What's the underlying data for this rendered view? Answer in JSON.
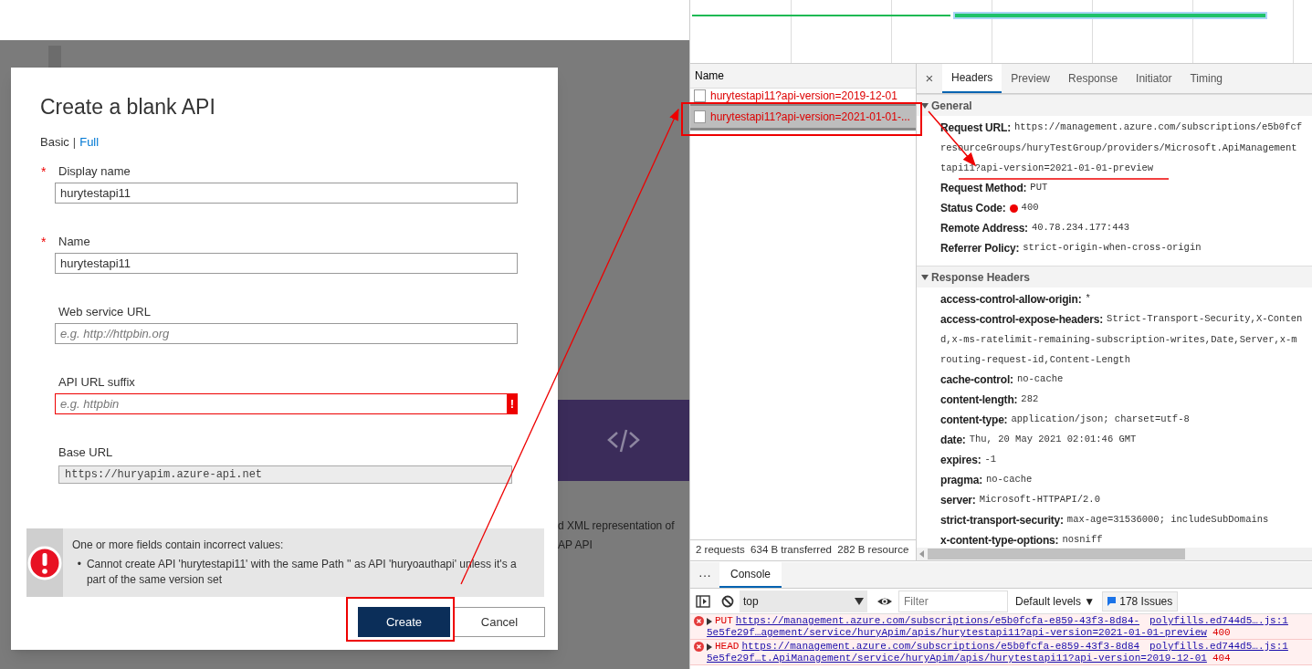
{
  "portal": {
    "dialog": {
      "title": "Create a blank API",
      "modes": [
        {
          "label": "Basic",
          "selected": true
        },
        {
          "label": "Full",
          "selected": false
        }
      ],
      "separator": "|",
      "fields": [
        {
          "kind": "text",
          "label": "Display name",
          "required": true,
          "value": "hurytestapi11"
        },
        {
          "kind": "text",
          "label": "Name",
          "required": true,
          "value": "hurytestapi11"
        },
        {
          "kind": "text",
          "label": "Web service URL",
          "placeholder": "e.g. http://httpbin.org"
        },
        {
          "kind": "text",
          "label": "API URL suffix",
          "placeholder": "e.g. httpbin",
          "error": true,
          "error_mark": "!"
        },
        {
          "kind": "readonly",
          "label": "Base URL",
          "value": "https://huryapim.azure-api.net"
        }
      ],
      "required_mark": "*",
      "error_banner": {
        "title": "One or more fields contain incorrect values:",
        "bullet": "•",
        "items": [
          "Cannot create API 'hurytestapi11' with the same Path '' as API 'huryoauthapi' unless it's a part of the same version set"
        ]
      },
      "buttons": [
        {
          "label": "Create",
          "primary": true
        },
        {
          "label": "Cancel",
          "primary": false
        }
      ]
    },
    "background_card": {
      "lines": [
        "d XML representation of",
        "AP API"
      ]
    }
  },
  "devtools": {
    "name_column": "Name",
    "requests": [
      {
        "name": "hurytestapi11?api-version=2019-12-01",
        "selected": false
      },
      {
        "name": "hurytestapi11?api-version=2021-01-01-...",
        "selected": true
      }
    ],
    "summary": [
      "2 requests",
      "634 B transferred",
      "282 B resource"
    ],
    "close": "×",
    "detail_tabs": [
      {
        "label": "Headers",
        "selected": true
      },
      {
        "label": "Preview",
        "selected": false
      },
      {
        "label": "Response",
        "selected": false
      },
      {
        "label": "Initiator",
        "selected": false
      },
      {
        "label": "Timing",
        "selected": false
      }
    ],
    "sections": [
      {
        "title": "General",
        "expanded": true,
        "rows": [
          {
            "name": "Request URL:",
            "value_lines": [
              "https://management.azure.com/subscriptions/e5b0fcf",
              "resourceGroups/huryTestGroup/providers/Microsoft.ApiManagement",
              "tapi11?api-version=2021-01-01-preview"
            ]
          },
          {
            "name": "Request Method:",
            "value_lines": [
              "PUT"
            ]
          },
          {
            "name": "Status Code:",
            "value_lines": [
              "400"
            ],
            "status_dot": true
          },
          {
            "name": "Remote Address:",
            "value_lines": [
              "40.78.234.177:443"
            ]
          },
          {
            "name": "Referrer Policy:",
            "value_lines": [
              "strict-origin-when-cross-origin"
            ]
          }
        ]
      },
      {
        "title": "Response Headers",
        "expanded": true,
        "rows": [
          {
            "name": "access-control-allow-origin:",
            "value_lines": [
              "*"
            ]
          },
          {
            "name": "access-control-expose-headers:",
            "value_lines": [
              "Strict-Transport-Security,X-Conten",
              "d,x-ms-ratelimit-remaining-subscription-writes,Date,Server,x-m",
              "routing-request-id,Content-Length"
            ]
          },
          {
            "name": "cache-control:",
            "value_lines": [
              "no-cache"
            ]
          },
          {
            "name": "content-length:",
            "value_lines": [
              "282"
            ]
          },
          {
            "name": "content-type:",
            "value_lines": [
              "application/json; charset=utf-8"
            ]
          },
          {
            "name": "date:",
            "value_lines": [
              "Thu, 20 May 2021 02:01:46 GMT"
            ]
          },
          {
            "name": "expires:",
            "value_lines": [
              "-1"
            ]
          },
          {
            "name": "pragma:",
            "value_lines": [
              "no-cache"
            ]
          },
          {
            "name": "server:",
            "value_lines": [
              "Microsoft-HTTPAPI/2.0"
            ]
          },
          {
            "name": "strict-transport-security:",
            "value_lines": [
              "max-age=31536000; includeSubDomains"
            ]
          },
          {
            "name": "x-content-type-options:",
            "value_lines": [
              "nosniff"
            ]
          }
        ]
      }
    ],
    "drawer": {
      "more": "···",
      "tabs": [
        {
          "label": "Console",
          "selected": true
        }
      ],
      "context": "top",
      "filter_placeholder": "Filter",
      "levels": "Default levels ▼",
      "issues": "178 Issues",
      "messages": [
        {
          "method": "PUT",
          "url_lines": [
            "https://management.azure.com/subscriptions/e5b0fcfa-e859-43f3-8d84-",
            "5e5fe29f…agement/service/huryApim/apis/hurytestapi11?api-version=2021-01-01-preview"
          ],
          "status": "400",
          "source": "polyfills.ed744d5….js:1"
        },
        {
          "method": "HEAD",
          "url_lines": [
            "https://management.azure.com/subscriptions/e5b0fcfa-e859-43f3-8d84",
            "5e5fe29f…t.ApiManagement/service/huryApim/apis/hurytestapi11?api-version=2019-12-01"
          ],
          "status": "404",
          "source": "polyfills.ed744d5….js:1"
        }
      ]
    }
  }
}
